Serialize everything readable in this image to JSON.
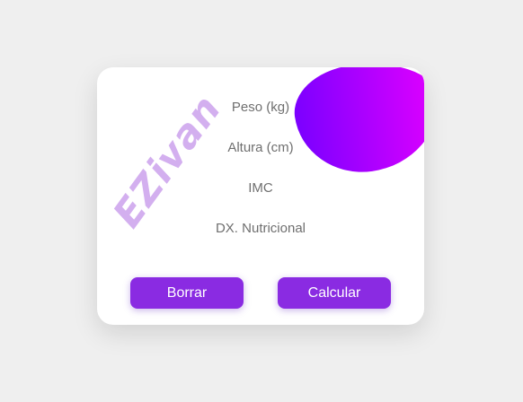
{
  "card": {
    "labels": {
      "weight": "Peso (kg)",
      "height": "Altura (cm)",
      "bmi": "IMC",
      "diagnosis": "DX. Nutricional"
    },
    "watermark": "EZivan",
    "buttons": {
      "clear": "Borrar",
      "calculate": "Calcular"
    }
  },
  "colors": {
    "accent": "#8a2be2",
    "blob_gradient_start": "#7b00ff",
    "blob_gradient_end": "#e000ff",
    "label_text": "#6f6f6f"
  }
}
